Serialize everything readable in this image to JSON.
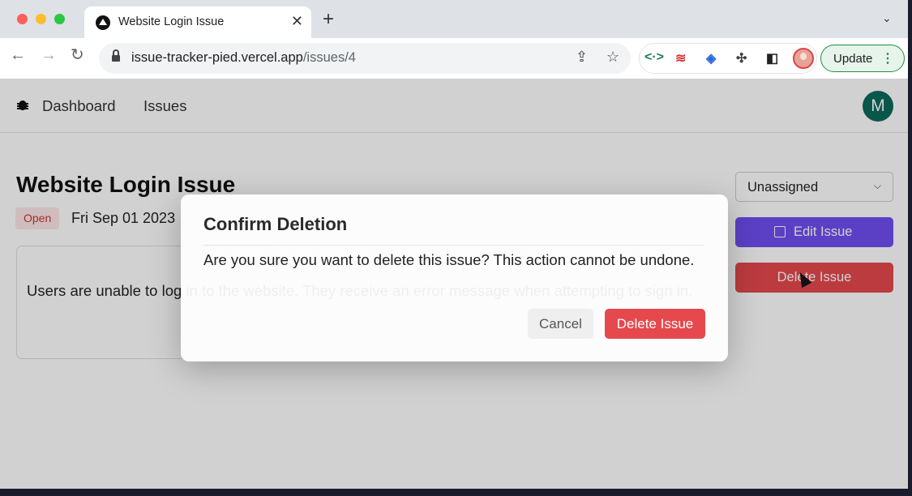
{
  "browser": {
    "tab_title": "Website Login Issue",
    "url_host": "issue-tracker-pied.vercel.app",
    "url_path": "/issues/4",
    "update_label": "Update",
    "colors": {
      "close": "#ff5f57",
      "minimize": "#febc2e",
      "maximize": "#28c840"
    }
  },
  "nav": {
    "dashboard": "Dashboard",
    "issues": "Issues",
    "avatar_initial": "M"
  },
  "issue": {
    "title": "Website Login Issue",
    "status": "Open",
    "date": "Fri Sep 01 2023",
    "description": "Users are unable to log in to the website. They receive an error message when attempting to sign in."
  },
  "sidebar": {
    "assignee": "Unassigned",
    "edit_label": "Edit Issue",
    "delete_label": "Delete Issue",
    "accent": "#6f4ff2",
    "danger": "#e5484d"
  },
  "dialog": {
    "title": "Confirm Deletion",
    "message": "Are you sure you want to delete this issue? This action cannot be undone.",
    "cancel_label": "Cancel",
    "confirm_label": "Delete Issue"
  },
  "icons": [
    "bug-icon",
    "lock-icon",
    "share-icon",
    "star-icon",
    "puzzle-icon",
    "sidepanel-icon",
    "edit-icon",
    "chevron-down-icon",
    "cursor-icon"
  ]
}
